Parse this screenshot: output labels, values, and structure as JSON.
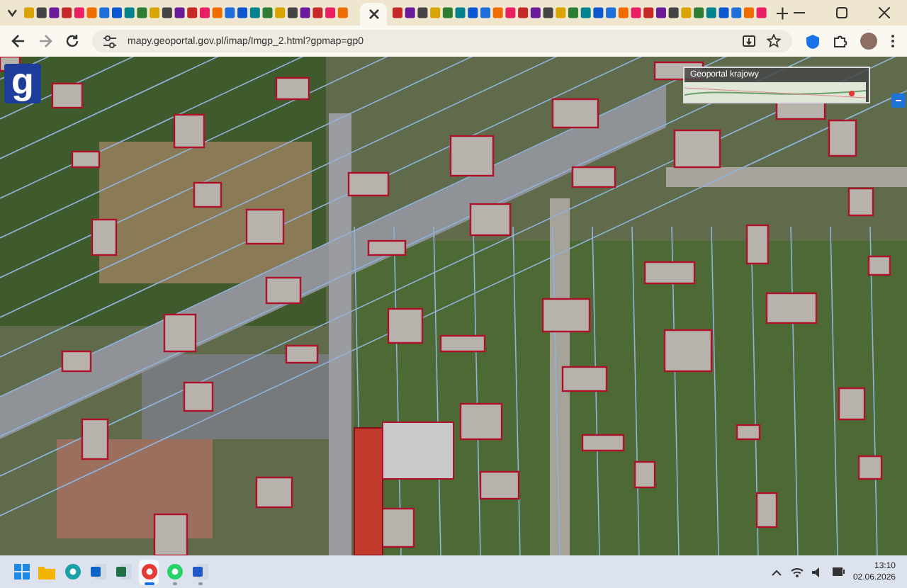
{
  "browser": {
    "url": "mapy.geoportal.gov.pl/imap/Imgp_2.html?gpmap=gp0"
  },
  "map": {
    "logo": "g",
    "overview": {
      "title": "Geoportal krajowy"
    }
  },
  "taskbar": {
    "apps": [
      {
        "kind": "start",
        "selected": false,
        "running": false
      },
      {
        "kind": "files",
        "selected": false,
        "running": false
      },
      {
        "kind": "edge",
        "selected": false,
        "running": false
      },
      {
        "kind": "outlook",
        "selected": false,
        "running": false
      },
      {
        "kind": "excel",
        "selected": false,
        "running": false
      },
      {
        "kind": "chrome",
        "selected": true,
        "running": true
      },
      {
        "kind": "whatsapp",
        "selected": false,
        "running": true
      },
      {
        "kind": "word",
        "selected": false,
        "running": true
      }
    ],
    "time": "13:10",
    "date": "02.06.2026"
  }
}
